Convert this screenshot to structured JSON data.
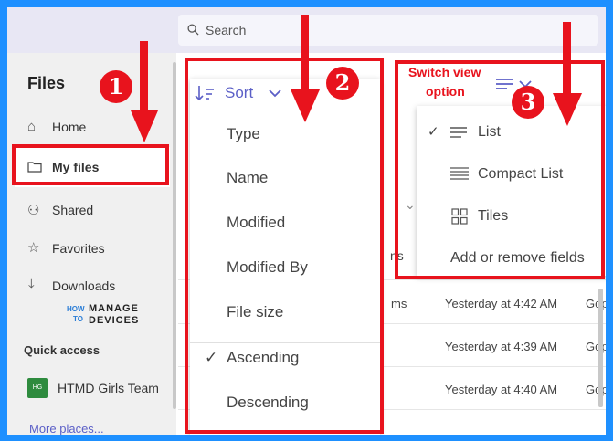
{
  "search": {
    "placeholder": "Search"
  },
  "sidebar": {
    "title": "Files",
    "items": [
      {
        "label": "Home",
        "icon": "home-icon"
      },
      {
        "label": "My files",
        "icon": "folder-icon"
      },
      {
        "label": "Shared",
        "icon": "shared-icon"
      },
      {
        "label": "Favorites",
        "icon": "star-icon"
      },
      {
        "label": "Downloads",
        "icon": "download-icon"
      }
    ],
    "quick_access_label": "Quick access",
    "team": {
      "initials": "HG",
      "name": "HTMD Girls Team"
    },
    "more_places": "More places..."
  },
  "logo": {
    "line1": "HOW",
    "line2": "TO",
    "word1": "MANAGE",
    "word2": "DEVICES"
  },
  "sort": {
    "label": "Sort",
    "options": [
      "Type",
      "Name",
      "Modified",
      "Modified By",
      "File size"
    ],
    "order": [
      "Ascending",
      "Descending"
    ],
    "checked": "Ascending"
  },
  "view": {
    "annotation": [
      "Switch view",
      "option"
    ],
    "options": [
      "List",
      "Compact List",
      "Tiles"
    ],
    "checked": "List",
    "add_remove": "Add or remove fields"
  },
  "files": {
    "partial_col": "ns",
    "rows": [
      {
        "name_frag": "ms",
        "modified": "Yesterday at 4:42 AM",
        "by": "Gopi"
      },
      {
        "name_frag": "",
        "modified": "Yesterday at 4:39 AM",
        "by": "Gopi"
      },
      {
        "name_frag": "",
        "modified": "Yesterday at 4:40 AM",
        "by": "Gopi"
      }
    ]
  },
  "badges": [
    "1",
    "2",
    "3"
  ],
  "colors": {
    "annotation_red": "#e8131d",
    "accent": "#5b5fc7",
    "background": "#1e90ff"
  }
}
